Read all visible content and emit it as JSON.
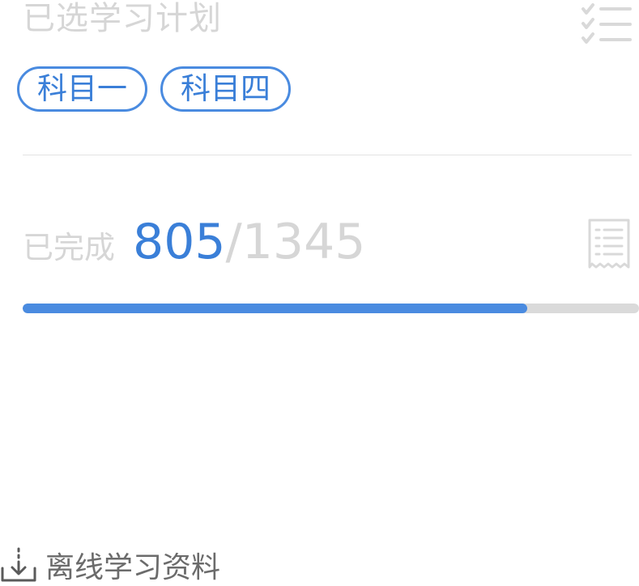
{
  "plan": {
    "title": "已选学习计划",
    "tags": [
      "科目一",
      "科目四"
    ]
  },
  "progress": {
    "label": "已完成",
    "done": "805",
    "total_text": "/1345",
    "fraction": 0.8186
  },
  "offline": {
    "label": "离线学习资料"
  },
  "colors": {
    "accent": "#4a8be0",
    "muted_text": "#d6d6d6",
    "track": "#dadada"
  },
  "icons": {
    "plan": "checklist-icon",
    "progress": "receipt-icon",
    "offline": "download-icon"
  }
}
